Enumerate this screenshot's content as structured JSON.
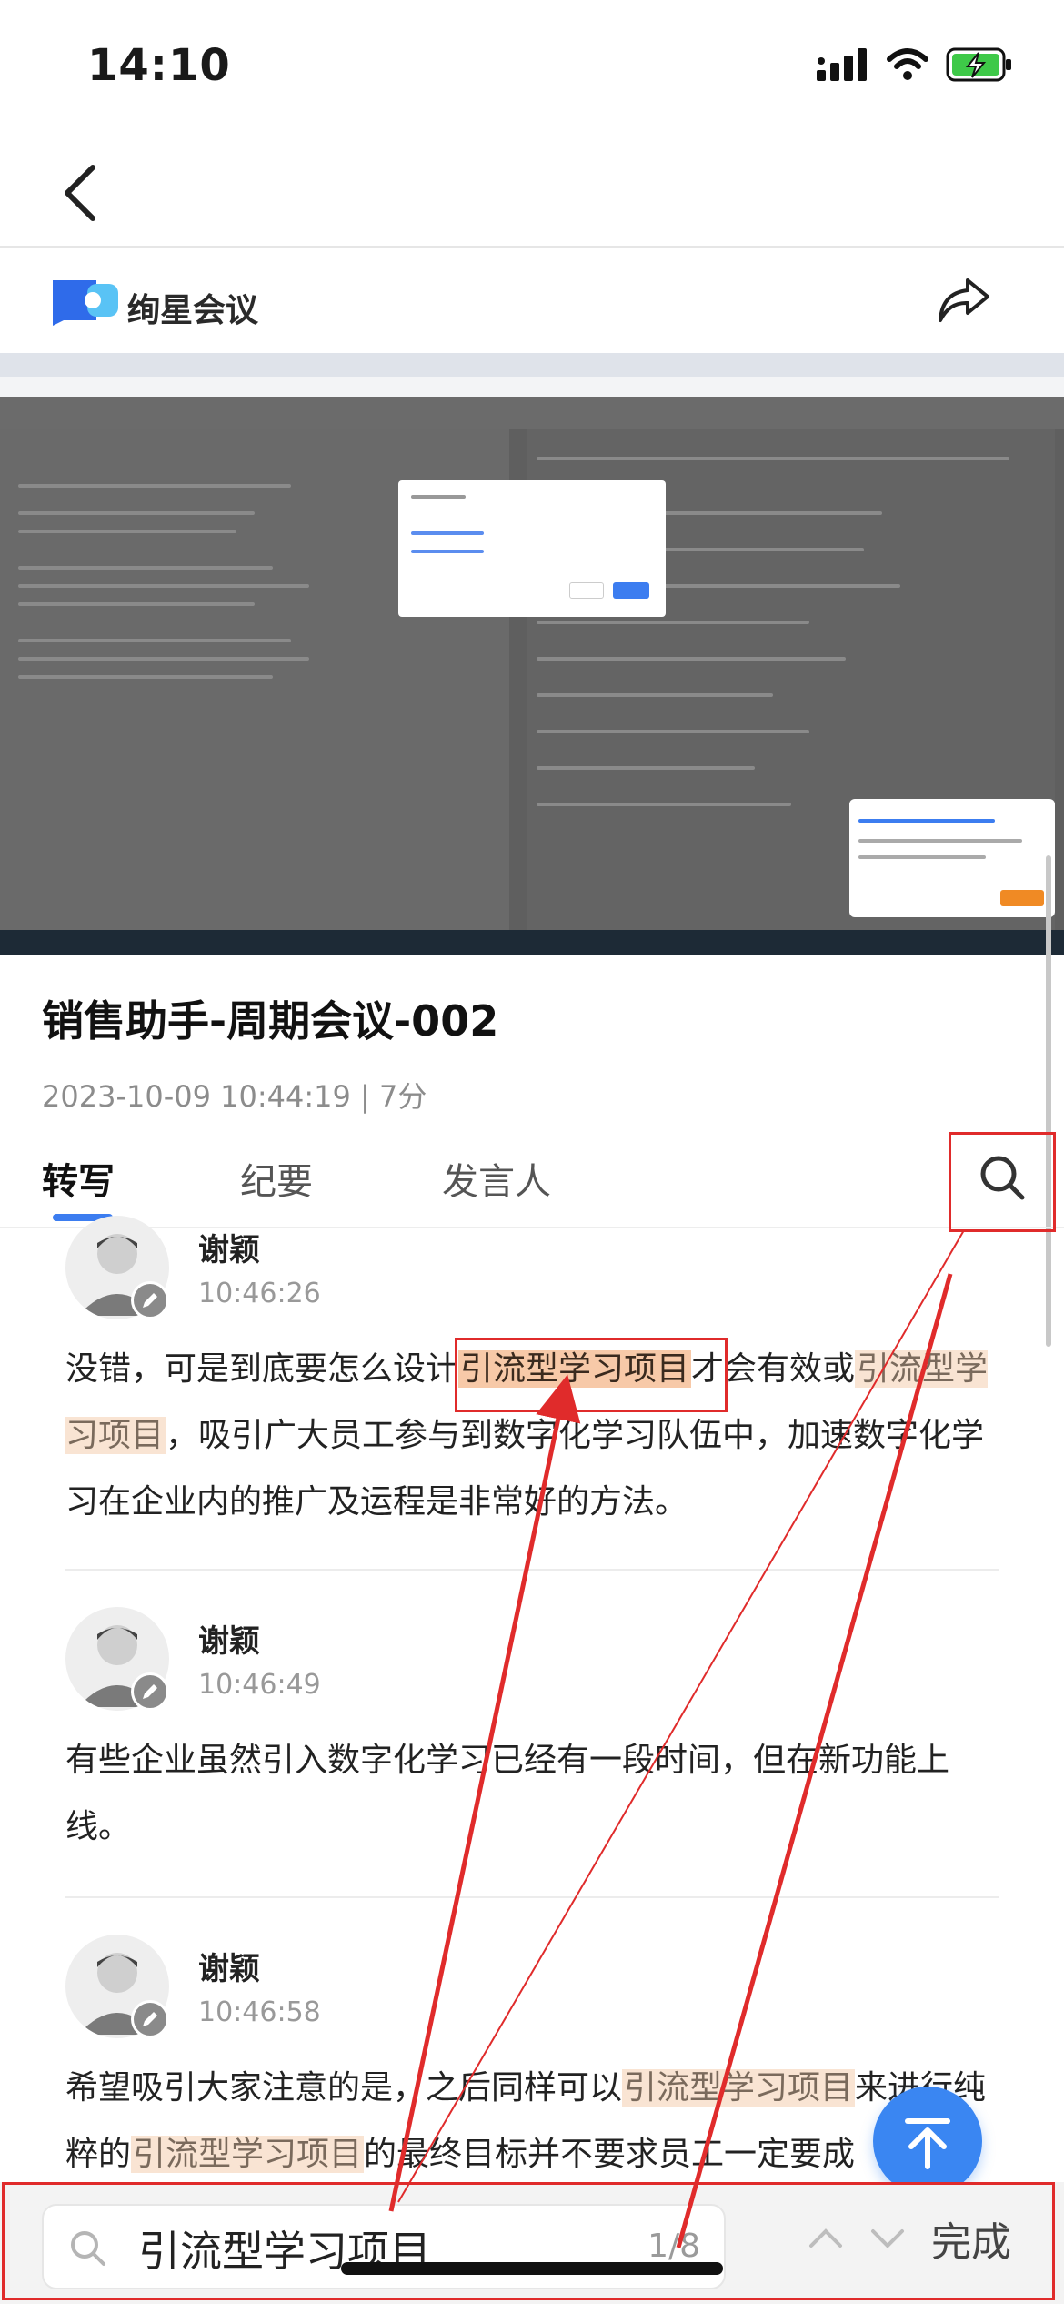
{
  "status_bar": {
    "time": "14:10"
  },
  "brand": {
    "name": "绚星会议"
  },
  "meeting": {
    "title": "销售助手-周期会议-002",
    "meta": "2023-10-09 10:44:19 | 7分"
  },
  "tabs": [
    {
      "label": "转写"
    },
    {
      "label": "纪要"
    },
    {
      "label": "发言人"
    }
  ],
  "entries": [
    {
      "speaker": "谢颖",
      "time": "10:46:26",
      "segments": [
        "没错，可是到底要怎么设计",
        "引流型学习项目",
        "才会有效或",
        "引流型学习项目",
        "，吸引广大员工参与到数字化学习队伍中，加速数字化学习在企业内的推广及运程是非常好的方法。"
      ]
    },
    {
      "speaker": "谢颖",
      "time": "10:46:49",
      "text": "有些企业虽然引入数字化学习已经有一段时间，但在新功能上线。"
    },
    {
      "speaker": "谢颖",
      "time": "10:46:58",
      "segments": [
        "希望吸引大家注意的是，之后同样可以",
        "引流型学习项目",
        "来进行纯粹的",
        "引流型学习项目",
        "的最终目标并不要求员工一定要成"
      ]
    }
  ],
  "search": {
    "query": "引流型学习项目",
    "count": "1/8",
    "done_label": "完成"
  },
  "colors": {
    "accent": "#3c7df0",
    "highlight": "#f9e4d3",
    "highlight_current": "#f7c9a8",
    "annotation_red": "#e02b2b"
  }
}
